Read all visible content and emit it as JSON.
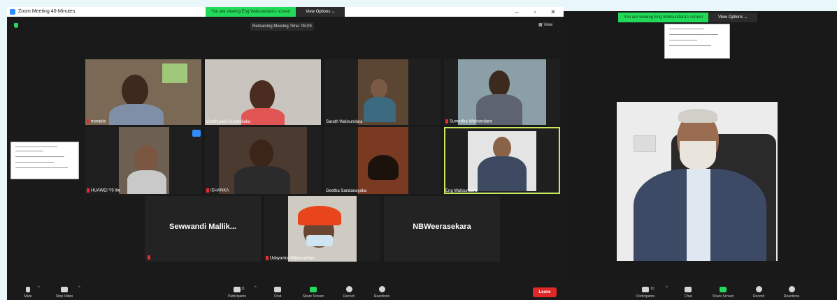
{
  "left_window": {
    "title": "Zoom Meeting 40-Minutes",
    "banner_text": "You are viewing Eng  Walisundara's screen",
    "view_options": "View Options ⌄",
    "remaining_time": "Remaining Meeting Time: 05:09",
    "view_button": "View",
    "participants": [
      {
        "name": "manjula"
      },
      {
        "name": "Chathurani Gunathilaka"
      },
      {
        "name": "Sarath Walisundara"
      },
      {
        "name": "Sumedha Walisundara"
      },
      {
        "name": "HUAWEI Y5 lite"
      },
      {
        "name": "ISHANKA"
      },
      {
        "name": "Geetha Sandanayaka"
      },
      {
        "name": "Eng  Walisundara"
      },
      {
        "name": "Sewwandi  Mallik..."
      },
      {
        "name": "Udayanka Wijayarathna"
      },
      {
        "name": "NBWeerasekara"
      }
    ],
    "toolbar": {
      "mute": "Mute",
      "stop_video": "Stop Video",
      "participants": "Participants",
      "participants_count": "11",
      "chat": "Chat",
      "share_screen": "Share Screen",
      "record": "Record",
      "reactions": "Reactions",
      "leave": "Leave"
    }
  },
  "right_window": {
    "banner_text": "You are viewing Eng  Walisundara's screen",
    "view_options": "View Options ⌄",
    "toolbar": {
      "participants": "Participants",
      "participants_count": "10",
      "chat": "Chat",
      "share_screen": "Share Screen",
      "record": "Record",
      "reactions": "Reactions"
    }
  },
  "colors": {
    "accent_green": "#23d959",
    "leave_red": "#e02828",
    "active_speaker": "#c8e65e"
  }
}
